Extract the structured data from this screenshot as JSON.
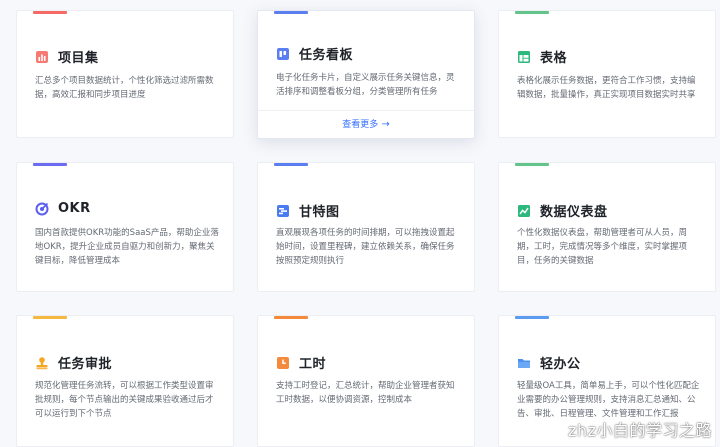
{
  "cards": [
    {
      "title": "项目集",
      "accent": "#f76964",
      "icon": "chart-bar-icon",
      "icon_color": "#f76964",
      "desc": "汇总多个项目数据统计，个性化筛选过滤所需数据，高效汇报和同步项目进度"
    },
    {
      "title": "任务看板",
      "accent": "#5b7ff0",
      "icon": "kanban-board-icon",
      "icon_color": "#5b7ff0",
      "desc": "电子化任务卡片，自定义展示任务关键信息，灵活排序和调整看板分组，分类管理所有任务",
      "more": "查看更多"
    },
    {
      "title": "表格",
      "accent": "#63c48a",
      "icon": "table-icon",
      "icon_color": "#2db87d",
      "desc": "表格化展示任务数据，更符合工作习惯，支持编辑数据，批量操作，真正实现项目数据实时共享"
    },
    {
      "title": "OKR",
      "accent": "#6b6cf0",
      "icon": "target-icon",
      "icon_color": "#5b5ff0",
      "desc": "国内首款提供OKR功能的SaaS产品，帮助企业落地OKR，提升企业成员自驱力和创新力，聚焦关键目标，降低管理成本"
    },
    {
      "title": "甘特图",
      "accent": "#5b7ff0",
      "icon": "gantt-chart-icon",
      "icon_color": "#4a7bf0",
      "desc": "直观展现各项任务的时间排期，可以拖拽设置起始时间，设置里程碑，建立依赖关系，确保任务按照预定规则执行"
    },
    {
      "title": "数据仪表盘",
      "accent": "#63c48a",
      "icon": "line-chart-icon",
      "icon_color": "#2db87d",
      "desc": "个性化数据仪表盘，帮助管理者可从人员，周期，工时，完成情况等多个维度，实时掌握项目，任务的关键数据"
    },
    {
      "title": "任务审批",
      "accent": "#f5b93f",
      "icon": "stamp-icon",
      "icon_color": "#f5a623",
      "desc": "规范化管理任务流转，可以根据工作类型设置审批规则，每个节点输出的关键成果验收通过后才可以运行到下个节点"
    },
    {
      "title": "工时",
      "accent": "#f58a3c",
      "icon": "clock-icon",
      "icon_color": "#f58a3c",
      "desc": "支持工时登记，汇总统计，帮助企业管理者获知工时数据，以便协调资源，控制成本"
    },
    {
      "title": "轻办公",
      "accent": "#5b9cf0",
      "icon": "folder-icon",
      "icon_color": "#4a90f0",
      "desc": "轻量级OA工具，简单易上手，可以个性化匹配企业需要的办公管理规则，支持消息汇总通知、公告、审批、日程管理、文件管理和工作汇报"
    }
  ],
  "watermark": "zhz小白的学习之路"
}
